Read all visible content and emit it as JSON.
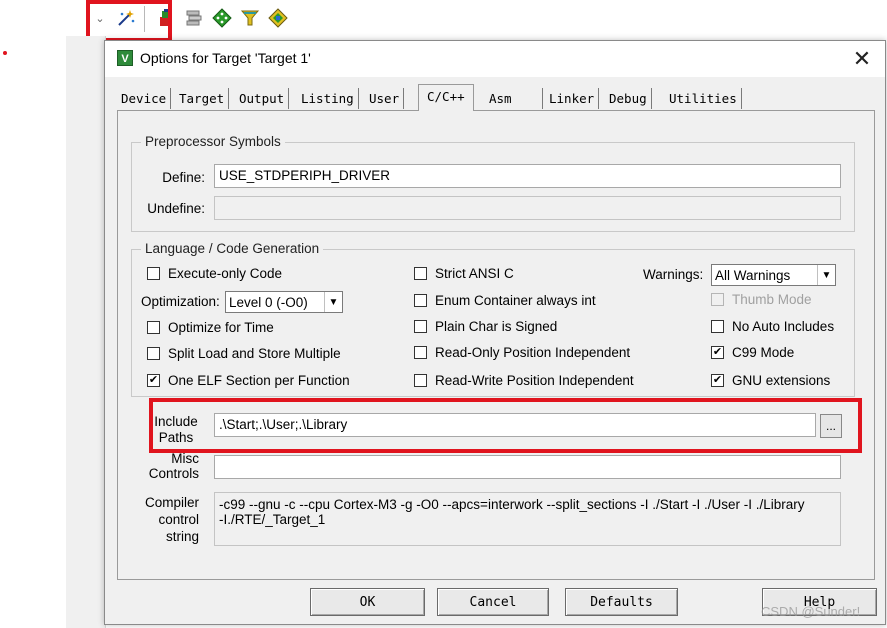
{
  "toolbar": {
    "icons": [
      "dropdown-icon",
      "magic-wand-icon",
      "load-icon",
      "manage-icon",
      "diamond-icon",
      "funnel-icon",
      "component-icon"
    ]
  },
  "colors": {
    "highlight": "#e0141e",
    "app_icon": "#2e8b3a"
  },
  "dialog": {
    "app_icon_text": "V",
    "title": "Options for Target 'Target 1'",
    "close": "✕"
  },
  "tabs": [
    "Device",
    "Target",
    "Output",
    "Listing",
    "User",
    "C/C++",
    "Asm",
    "Linker",
    "Debug",
    "Utilities"
  ],
  "active_tab": "C/C++",
  "preprocessor": {
    "title": "Preprocessor Symbols",
    "define_label": "Define:",
    "define_value": "USE_STDPERIPH_DRIVER",
    "undefine_label": "Undefine:",
    "undefine_value": ""
  },
  "language": {
    "title": "Language / Code Generation",
    "execute_only": {
      "label": "Execute-only Code",
      "checked": false
    },
    "optimization_label": "Optimization:",
    "optimization_value": "Level 0 (-O0)",
    "optimize_time": {
      "label": "Optimize for Time",
      "checked": false
    },
    "split_load": {
      "label": "Split Load and Store Multiple",
      "checked": false
    },
    "one_elf": {
      "label": "One ELF Section per Function",
      "checked": true
    },
    "strict_ansi": {
      "label": "Strict ANSI C",
      "checked": false
    },
    "enum_container": {
      "label": "Enum Container always int",
      "checked": false
    },
    "plain_char": {
      "label": "Plain Char is Signed",
      "checked": false
    },
    "ro_position": {
      "label": "Read-Only Position Independent",
      "checked": false
    },
    "rw_position": {
      "label": "Read-Write Position Independent",
      "checked": false
    },
    "warnings_label": "Warnings:",
    "warnings_value": "All Warnings",
    "thumb_mode": {
      "label": "Thumb Mode",
      "checked": false
    },
    "no_auto_includes": {
      "label": "No Auto Includes",
      "checked": false
    },
    "c99_mode": {
      "label": "C99 Mode",
      "checked": true
    },
    "gnu_extensions": {
      "label": "GNU extensions",
      "checked": true
    }
  },
  "include": {
    "label_line1": "Include",
    "label_line2": "Paths",
    "value": ".\\Start;.\\User;.\\Library",
    "browse": "..."
  },
  "misc": {
    "label_line1": "Misc",
    "label_line2": "Controls",
    "value": ""
  },
  "compiler": {
    "label_line1": "Compiler",
    "label_line2": "control",
    "label_line3": "string",
    "line1": "-c99 --gnu -c --cpu Cortex-M3 -g -O0 --apcs=interwork --split_sections -I ./Start -I ./User -I ./Library",
    "line2": "-I./RTE/_Target_1"
  },
  "buttons": {
    "ok": "OK",
    "cancel": "Cancel",
    "defaults": "Defaults",
    "help": "Help"
  },
  "watermark": "CSDN @Sunder!"
}
